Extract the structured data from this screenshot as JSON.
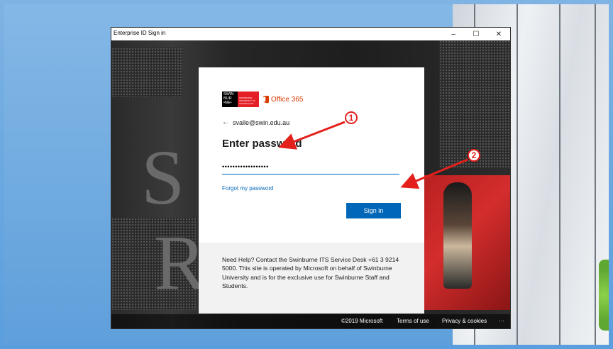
{
  "window": {
    "title": "Enterprise ID Sign in",
    "minimize_glyph": "–",
    "maximize_glyph": "☐",
    "close_glyph": "✕"
  },
  "brand": {
    "swin_logo_text": "SWIN BUR •NE•",
    "swin_tag_text": "SWINBURNE UNIVERSITY OF TECHNOLOGY",
    "product_name": "Office 365",
    "icon": "office-logo-icon"
  },
  "signin": {
    "back_glyph": "←",
    "account": "svalle@swin.edu.au",
    "heading": "Enter password",
    "password_value": "••••••••••••••••••",
    "forgot_link": "Forgot my password",
    "signin_button": "Sign in"
  },
  "help": {
    "text": "Need Help? Contact the Swinburne ITS Service Desk +61 3 9214 5000. This site is operated by Microsoft on behalf of Swinburne University and is for the exclusive use for Swinburne Staff and Students."
  },
  "footer": {
    "copyright": "©2019 Microsoft",
    "terms": "Terms of use",
    "privacy": "Privacy & cookies",
    "more": "···"
  },
  "annotations": {
    "callout_1": "1",
    "callout_2": "2",
    "arrow_color": "#e3201c"
  },
  "colors": {
    "accent": "#0067b8",
    "swin_red": "#e41f26",
    "office_orange": "#d83b01"
  }
}
